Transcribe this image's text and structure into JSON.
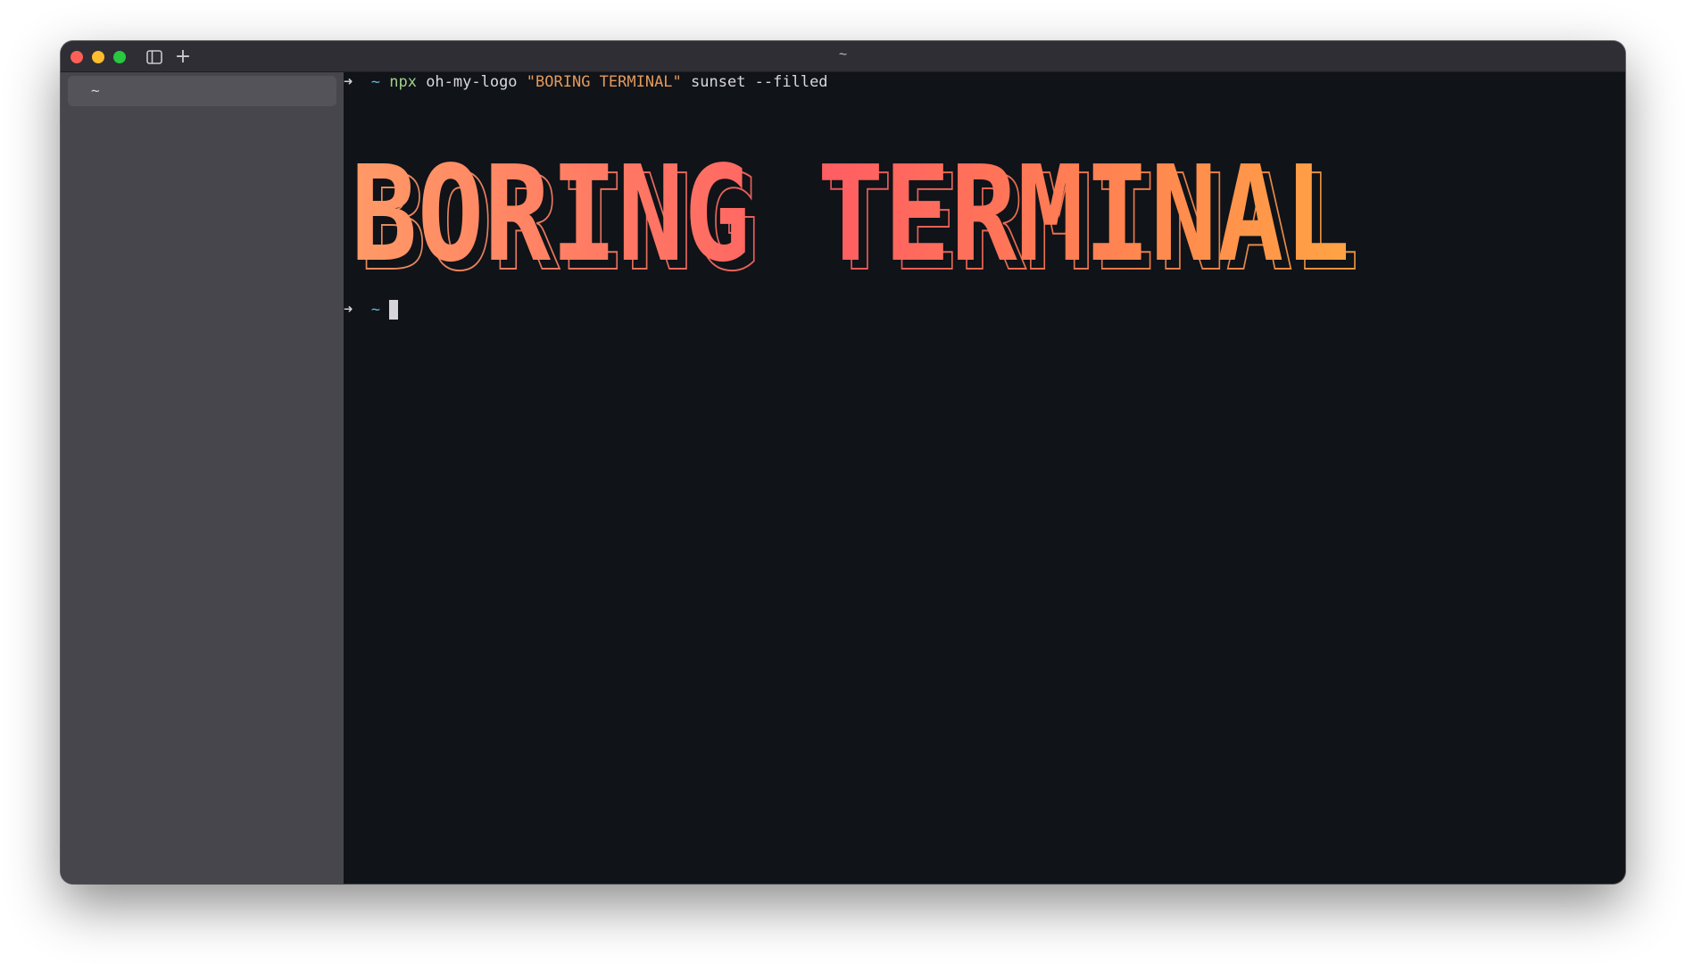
{
  "window": {
    "title": "~"
  },
  "titlebar": {
    "icons": [
      "close-button",
      "minimize-button",
      "zoom-button",
      "sidebar-toggle-icon",
      "plus-icon"
    ],
    "new_tab_label": "+"
  },
  "sidebar": {
    "items": [
      {
        "label": "~",
        "selected": true
      }
    ]
  },
  "terminal": {
    "prompt_arrow": "➜",
    "prompt_dir": "~",
    "command": {
      "program": "npx",
      "args_before": " oh-my-logo ",
      "string_arg": "\"BORING TERMINAL\"",
      "args_after": " sunset --filled"
    },
    "logo_text": "BORING TERMINAL",
    "logo_palette": "sunset",
    "colors": {
      "background": "#101318",
      "gradient_start": "#ff9a66",
      "gradient_mid": "#ff5e62",
      "gradient_end": "#ffa344",
      "prompt_dir": "#5fb3d6",
      "npx": "#9fd08a",
      "string": "#e39a5c"
    }
  }
}
